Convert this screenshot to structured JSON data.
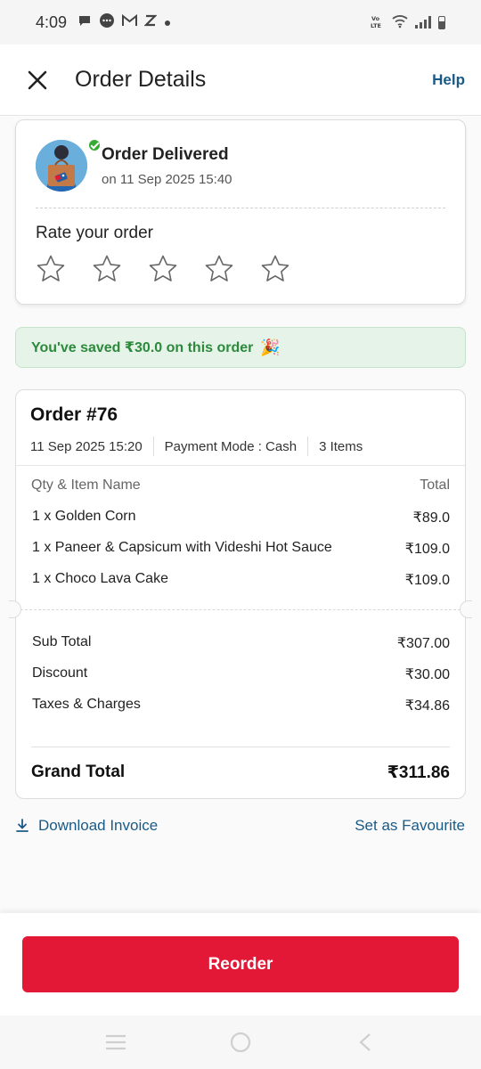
{
  "status_bar": {
    "time": "4:09",
    "notification_icons": [
      "chat-bubble-icon",
      "message-icon",
      "gmail-icon",
      "z-icon",
      "dot-icon"
    ],
    "network_label": "VoLTE"
  },
  "header": {
    "title": "Order Details",
    "help_label": "Help"
  },
  "delivery": {
    "status_title": "Order Delivered",
    "date_text": "on 11 Sep 2025 15:40",
    "rate_label": "Rate your order",
    "stars_count": 5
  },
  "savings": {
    "text": "You've saved ₹30.0 on this order",
    "emoji": "🎉"
  },
  "order": {
    "title": "Order #76",
    "date": "11 Sep 2025 15:20",
    "payment_mode": "Payment Mode : Cash",
    "items_count": "3 Items",
    "col_item": "Qty & Item Name",
    "col_total": "Total",
    "items": [
      {
        "name": "1 x Golden Corn",
        "price": "₹89.0"
      },
      {
        "name": "1 x Paneer & Capsicum with Videshi Hot Sauce",
        "price": "₹109.0"
      },
      {
        "name": "1 x Choco Lava Cake",
        "price": "₹109.0"
      }
    ],
    "summary": [
      {
        "label": "Sub Total",
        "value": "₹307.00"
      },
      {
        "label": "Discount",
        "value": "₹30.00"
      },
      {
        "label": "Taxes & Charges",
        "value": "₹34.86"
      }
    ],
    "grand_total_label": "Grand Total",
    "grand_total_value": "₹311.86"
  },
  "actions": {
    "download_label": "Download Invoice",
    "favourite_label": "Set as Favourite"
  },
  "reorder_label": "Reorder",
  "colors": {
    "accent_red": "#e31837",
    "link_blue": "#1a5a86",
    "savings_green": "#2c8a3c"
  }
}
